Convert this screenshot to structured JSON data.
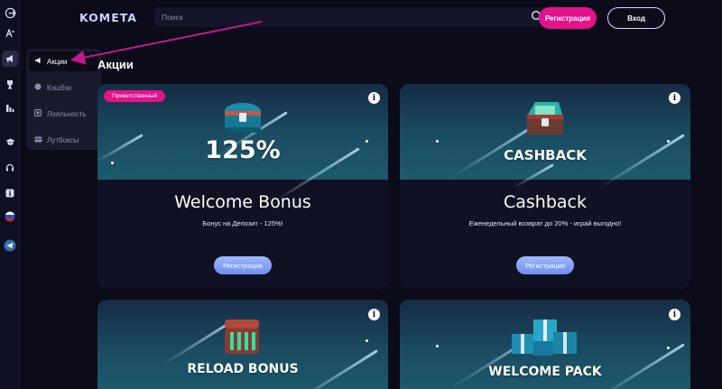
{
  "header": {
    "logo": "KOMETA",
    "search_placeholder": "Поиск",
    "register_label": "Регистрация",
    "login_label": "Вход"
  },
  "rail": {
    "icons": [
      "logout-icon",
      "translate-icon",
      "megaphone-icon",
      "trophy-icon",
      "stats-icon",
      "graduation-icon",
      "headset-icon",
      "info-icon",
      "russia-flag-icon",
      "telegram-icon"
    ]
  },
  "flyout": {
    "items": [
      {
        "label": "Акции",
        "icon": "megaphone-icon",
        "active": true
      },
      {
        "label": "Кэшбэк",
        "icon": "coin-icon",
        "active": false
      },
      {
        "label": "Лояльность",
        "icon": "loyalty-icon",
        "active": false
      },
      {
        "label": "Лутбоксы",
        "icon": "lootbox-icon",
        "active": false
      }
    ]
  },
  "page_title": "Акции",
  "cards": [
    {
      "badge": "Приветственный",
      "banner_text": "125%",
      "title": "Welcome Bonus",
      "subtitle": "Бонус на Депозит - 125%!",
      "button": "Регистрация"
    },
    {
      "banner_text": "CASHBACK",
      "title": "Cashback",
      "subtitle": "Еженедельный возврат до 20% - играй выгодно!",
      "button": "Регистрация"
    },
    {
      "banner_text": "RELOAD BONUS"
    },
    {
      "banner_text": "WELCOME PACK"
    }
  ],
  "colors": {
    "background": "#0b0b1a",
    "accent_pink": "#e5128e",
    "card_button": "#8aa6fb",
    "annotation_arrow": "#c0188a"
  }
}
